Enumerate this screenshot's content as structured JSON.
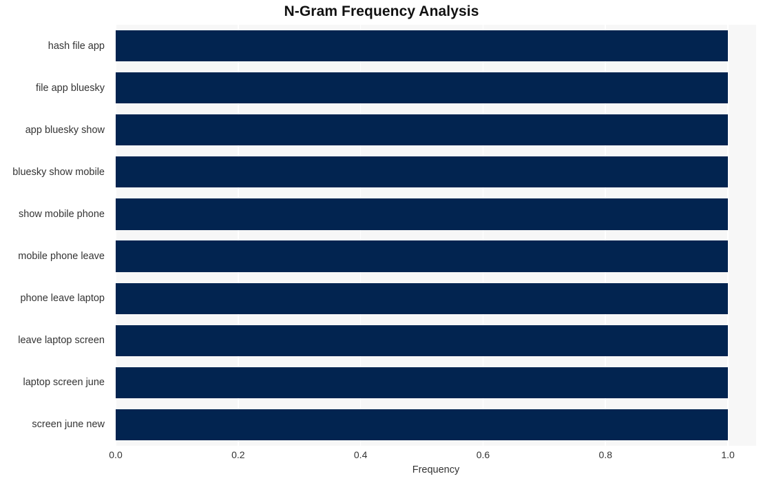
{
  "chart_data": {
    "type": "bar",
    "orientation": "horizontal",
    "title": "N-Gram Frequency Analysis",
    "xlabel": "Frequency",
    "ylabel": "",
    "categories": [
      "hash file app",
      "file app bluesky",
      "app bluesky show",
      "bluesky show mobile",
      "show mobile phone",
      "mobile phone leave",
      "phone leave laptop",
      "leave laptop screen",
      "laptop screen june",
      "screen june new"
    ],
    "values": [
      1.0,
      1.0,
      1.0,
      1.0,
      1.0,
      1.0,
      1.0,
      1.0,
      1.0,
      1.0
    ],
    "xticks": [
      "0.0",
      "0.2",
      "0.4",
      "0.6",
      "0.8",
      "1.0"
    ],
    "xtick_values": [
      0.0,
      0.2,
      0.4,
      0.6,
      0.8,
      1.0
    ],
    "xlim": [
      0.0,
      1.046
    ],
    "grid": "vertical",
    "legend": "none",
    "bar_color": "#022450",
    "plot_background": "#f7f7f7",
    "gridline_color": "#ffffff",
    "figure_background": "#ffffff"
  }
}
